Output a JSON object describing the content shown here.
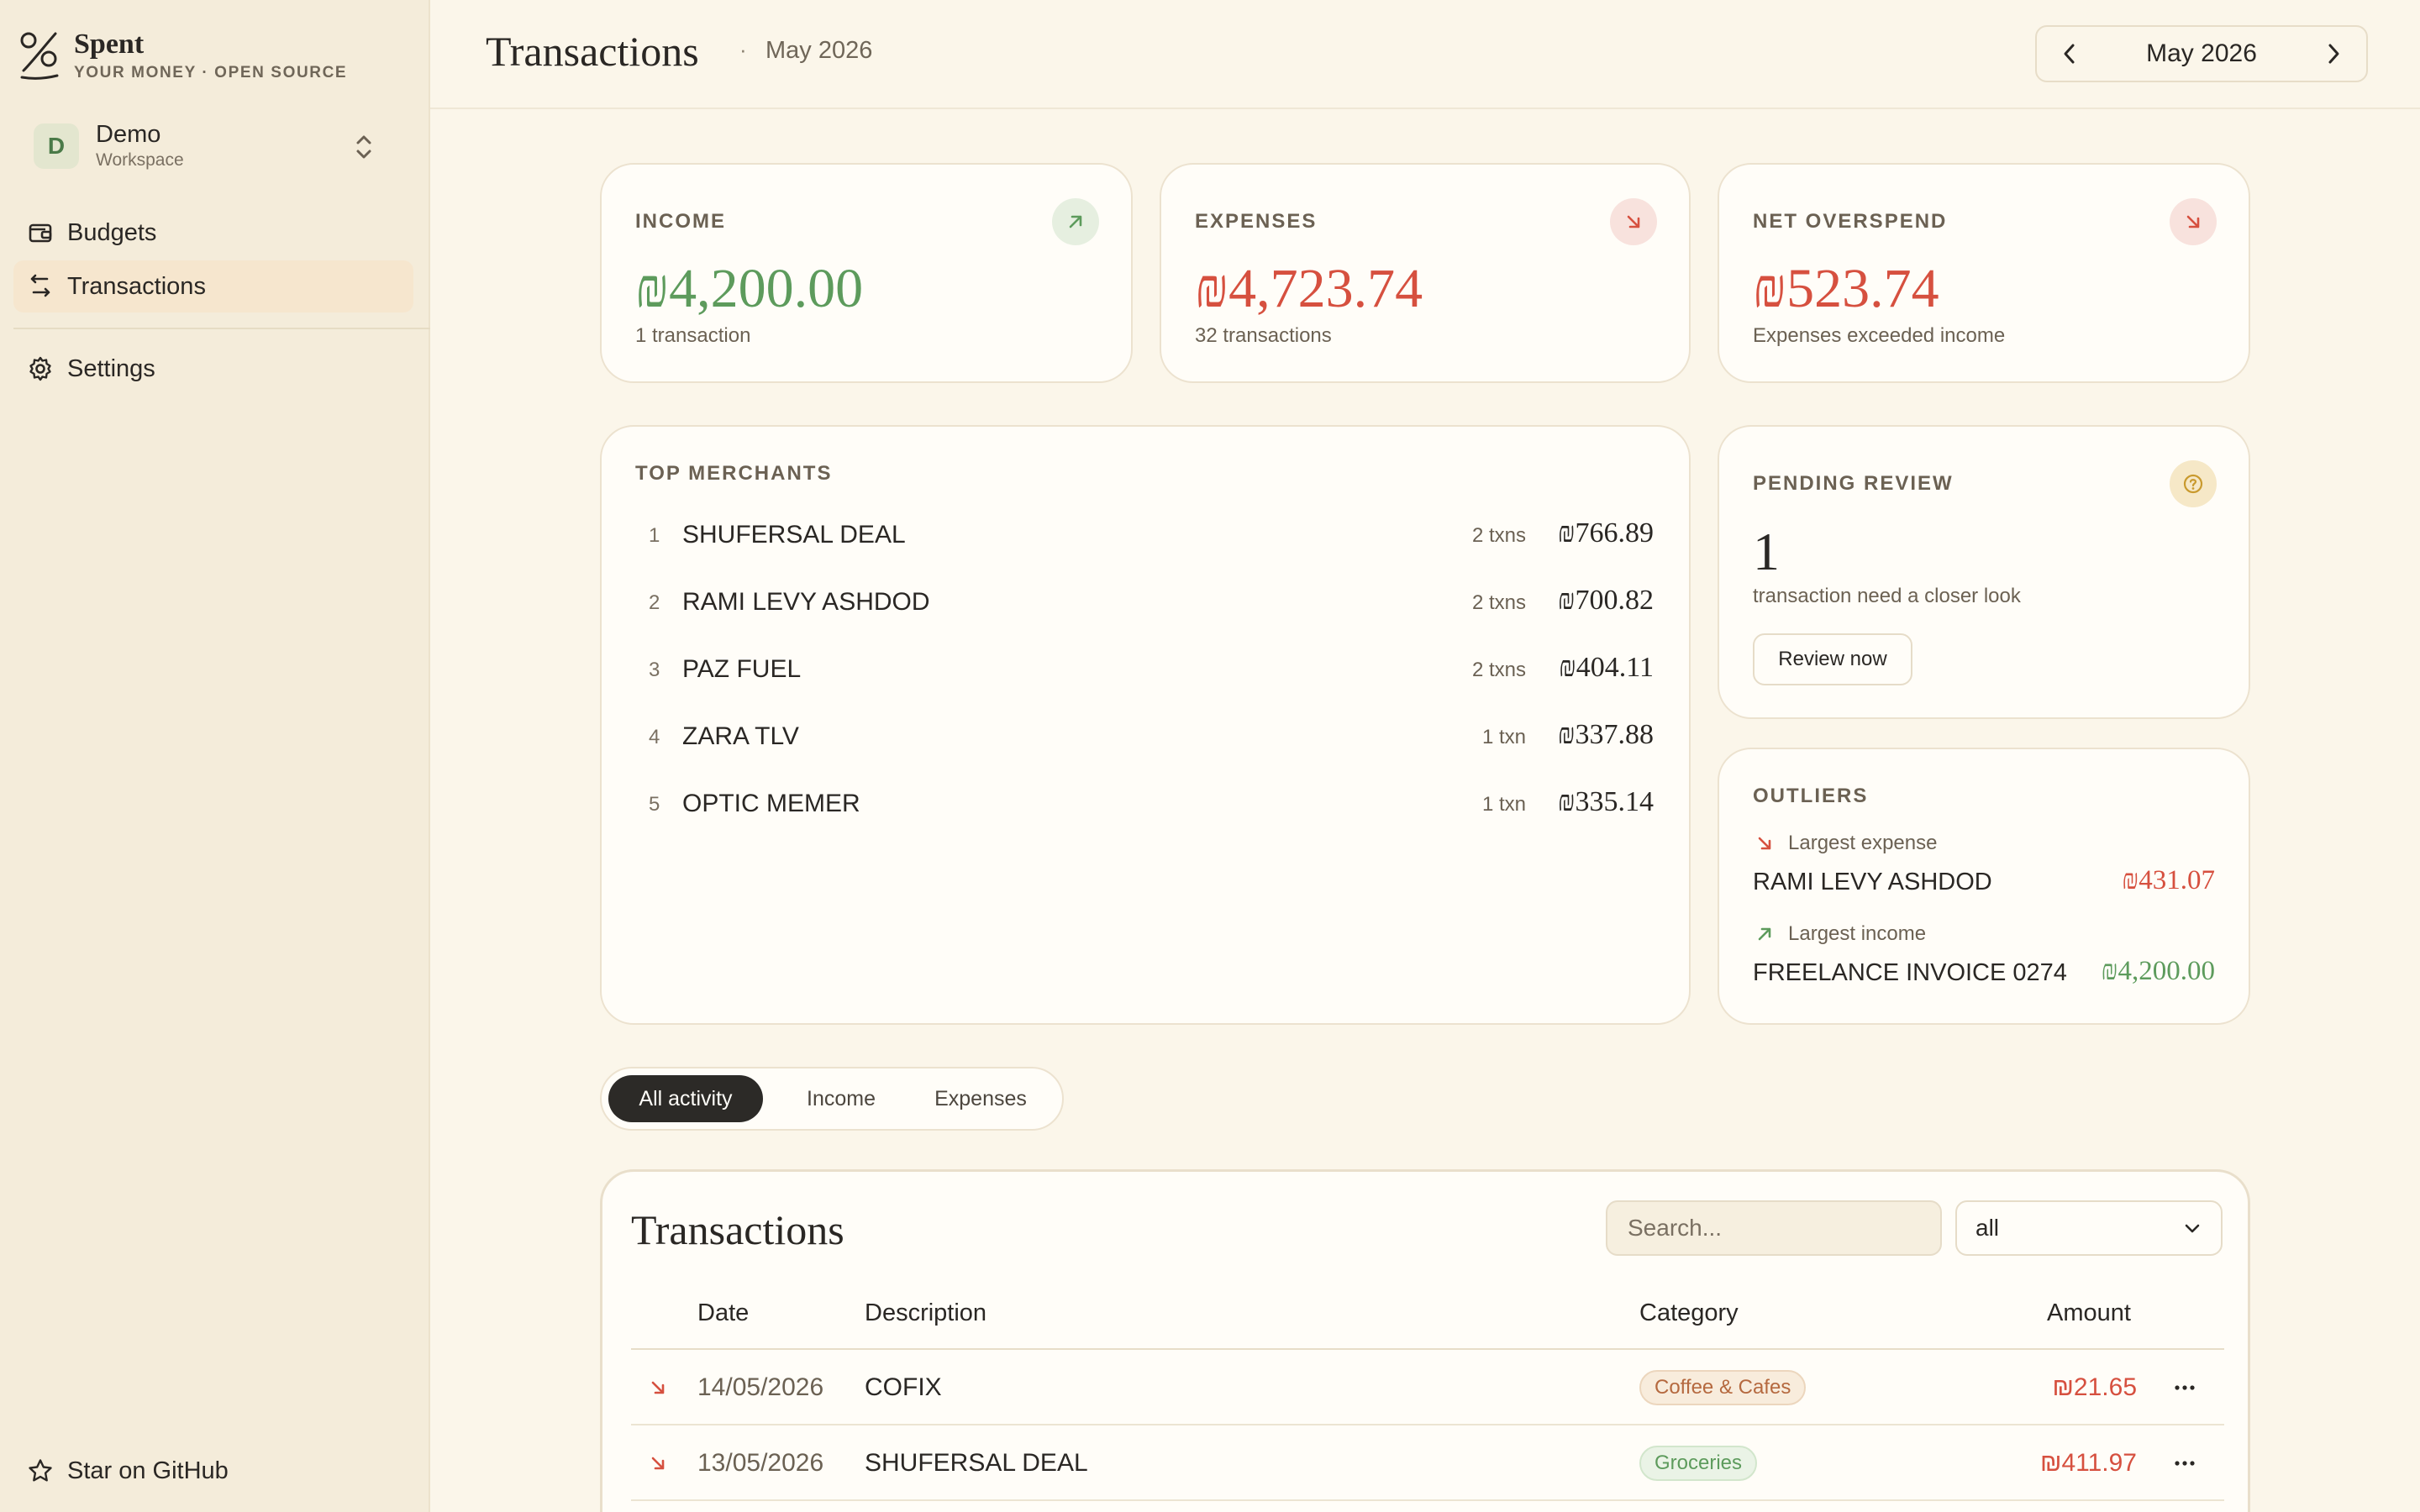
{
  "brand": {
    "name": "Spent",
    "tagline": "YOUR MONEY · OPEN SOURCE"
  },
  "workspace": {
    "initial": "D",
    "name": "Demo",
    "type": "Workspace"
  },
  "nav": {
    "budgets": "Budgets",
    "transactions": "Transactions",
    "settings": "Settings",
    "github": "Star on GitHub"
  },
  "header": {
    "title": "Transactions",
    "separator": "·",
    "subtitle": "May 2026",
    "month": "May 2026"
  },
  "summary": {
    "income": {
      "label": "INCOME",
      "amount": "₪4,200.00",
      "sub": "1 transaction"
    },
    "expenses": {
      "label": "EXPENSES",
      "amount": "₪4,723.74",
      "sub": "32 transactions"
    },
    "net": {
      "label": "NET OVERSPEND",
      "amount": "₪523.74",
      "sub": "Expenses exceeded income"
    }
  },
  "top_merchants": {
    "label": "TOP MERCHANTS",
    "items": [
      {
        "rank": "1",
        "name": "SHUFERSAL DEAL",
        "count": "2 txns",
        "amount": "₪766.89"
      },
      {
        "rank": "2",
        "name": "RAMI LEVY ASHDOD",
        "count": "2 txns",
        "amount": "₪700.82"
      },
      {
        "rank": "3",
        "name": "PAZ FUEL",
        "count": "2 txns",
        "amount": "₪404.11"
      },
      {
        "rank": "4",
        "name": "ZARA TLV",
        "count": "1 txn",
        "amount": "₪337.88"
      },
      {
        "rank": "5",
        "name": "OPTIC MEMER",
        "count": "1 txn",
        "amount": "₪335.14"
      }
    ]
  },
  "pending": {
    "label": "PENDING REVIEW",
    "count": "1",
    "sub": "transaction need a closer look",
    "button": "Review now"
  },
  "outliers": {
    "label": "OUTLIERS",
    "expense_label": "Largest expense",
    "expense_name": "RAMI LEVY ASHDOD",
    "expense_amount": "₪431.07",
    "income_label": "Largest income",
    "income_name": "FREELANCE INVOICE 0274",
    "income_amount": "₪4,200.00"
  },
  "filter_tabs": {
    "all": "All activity",
    "income": "Income",
    "expenses": "Expenses"
  },
  "table": {
    "title": "Transactions",
    "search_placeholder": "Search...",
    "select_value": "all",
    "columns": {
      "date": "Date",
      "description": "Description",
      "category": "Category",
      "amount": "Amount"
    },
    "rows": [
      {
        "date": "14/05/2026",
        "description": "COFIX",
        "category": "Coffee & Cafes",
        "amount": "₪21.65"
      },
      {
        "date": "13/05/2026",
        "description": "SHUFERSAL DEAL",
        "category": "Groceries",
        "amount": "₪411.97"
      }
    ]
  },
  "colors": {
    "background": "#fbf6ea",
    "sidebar": "#f4ecda",
    "income_green": "#5d9b5c",
    "expense_red": "#d6503f",
    "dark": "#2c2a27"
  }
}
